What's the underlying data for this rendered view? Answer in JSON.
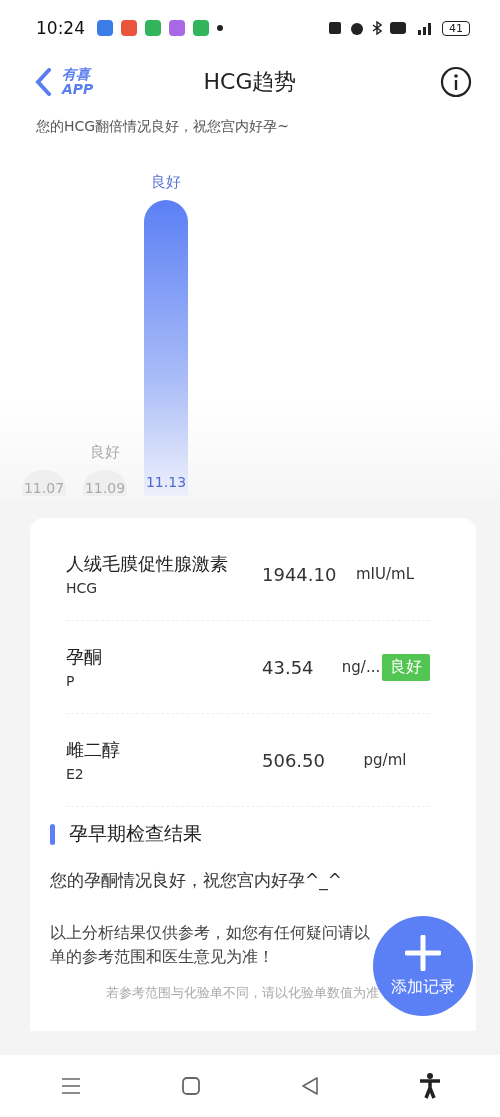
{
  "status_bar": {
    "time": "10:24",
    "battery": "41"
  },
  "header": {
    "logo_top": "有喜",
    "logo_bottom": "APP",
    "title": "HCG趋势"
  },
  "subtitle": "您的HCG翻倍情况良好，祝您宫内好孕~",
  "trend": [
    {
      "date": "11.07",
      "selected": false
    },
    {
      "date": "11.09",
      "status": "良好",
      "selected": false
    },
    {
      "date": "11.13",
      "status": "良好",
      "selected": true
    }
  ],
  "results": [
    {
      "name": "人绒毛膜促性腺激素",
      "abbr": "HCG",
      "value": "1944.10",
      "unit": "mIU/mL"
    },
    {
      "name": "孕酮",
      "abbr": "P",
      "value": "43.54",
      "unit": "ng/...",
      "badge": "良好"
    },
    {
      "name": "雌二醇",
      "abbr": "E2",
      "value": "506.50",
      "unit": "pg/ml"
    }
  ],
  "section_title": "孕早期检查结果",
  "conclusion": "您的孕酮情况良好，祝您宫内好孕^_^",
  "disclaimer_lines": [
    "以上分析结果仅供参考，如您有任何疑问请以",
    "单的参考范围和医生意见为准！"
  ],
  "footnote": "若参考范围与化验单不同，请以化验单数值为准",
  "fab": {
    "label": "添加记录"
  }
}
